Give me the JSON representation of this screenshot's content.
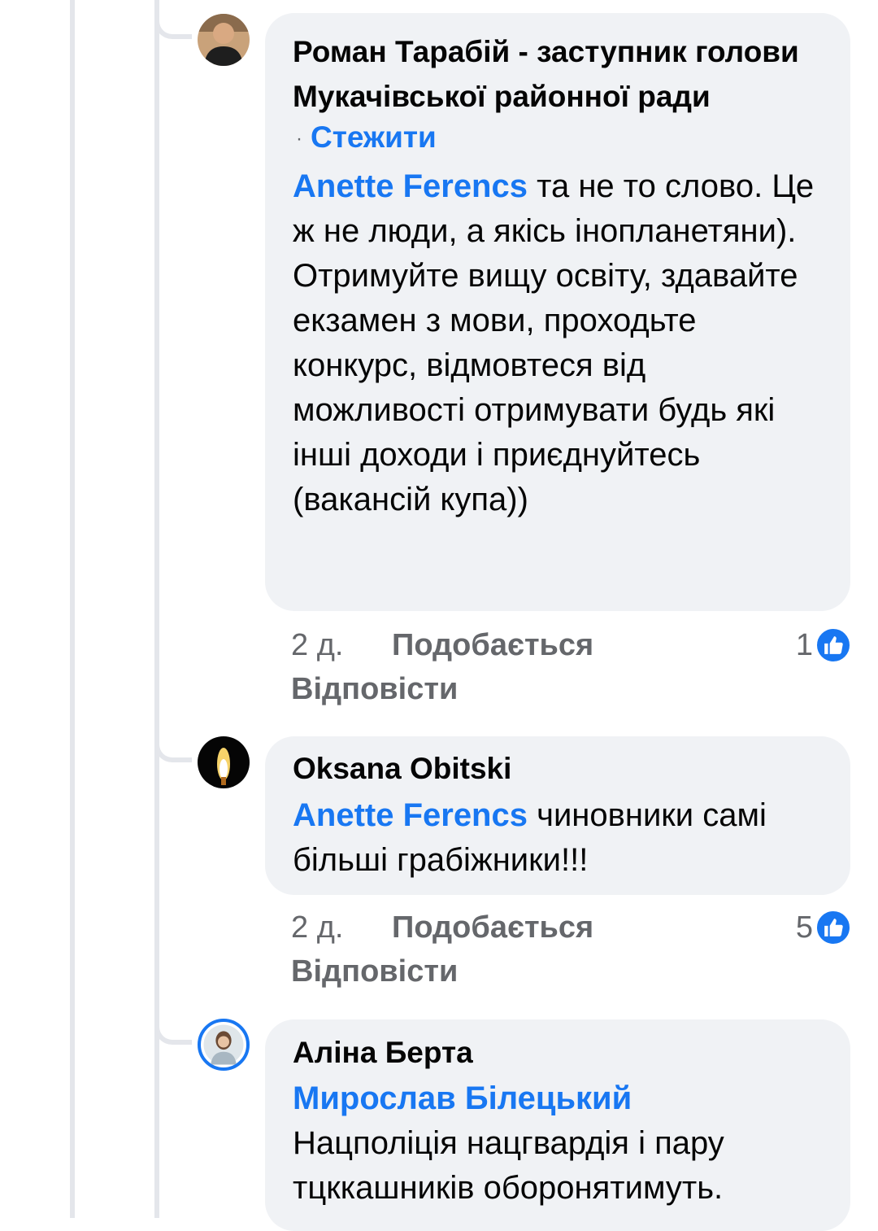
{
  "comments": [
    {
      "author": "Роман Тарабій - заступник голови Мукачівської районної ради",
      "follow_label": "Стежити",
      "follow_dot": "·",
      "mention": "Anette Ferencs",
      "text": " та не то слово. Це ж не люди, а якісь інопланетяни). Отримуйте вищу освіту, здавайте екзамен з мови,  проходьте конкурс, відмовтеся від можливості отримувати будь які інші доходи і приєднуйтесь (вакансій купа))",
      "time": "2 д.",
      "like_label": "Подобається",
      "reply_label": "Відповісти",
      "reaction_count": "1",
      "reaction_icon": "like-icon"
    },
    {
      "author": "Oksana Obitski",
      "mention": "Anette Ferencs",
      "text": " чиновники самі більші грабіжники!!!",
      "time": "2 д.",
      "like_label": "Подобається",
      "reply_label": "Відповісти",
      "reaction_count": "5",
      "reaction_icon": "like-icon"
    },
    {
      "author": "Аліна Берта",
      "mention": "Мирослав Білецький",
      "text": "Нацполіція нацгвардія і пару тцккашників оборонятимуть."
    }
  ],
  "colors": {
    "accent": "#1877f2",
    "bubble": "#f0f2f5",
    "secondary_text": "#65676b",
    "thread_line": "#e4e6eb"
  }
}
